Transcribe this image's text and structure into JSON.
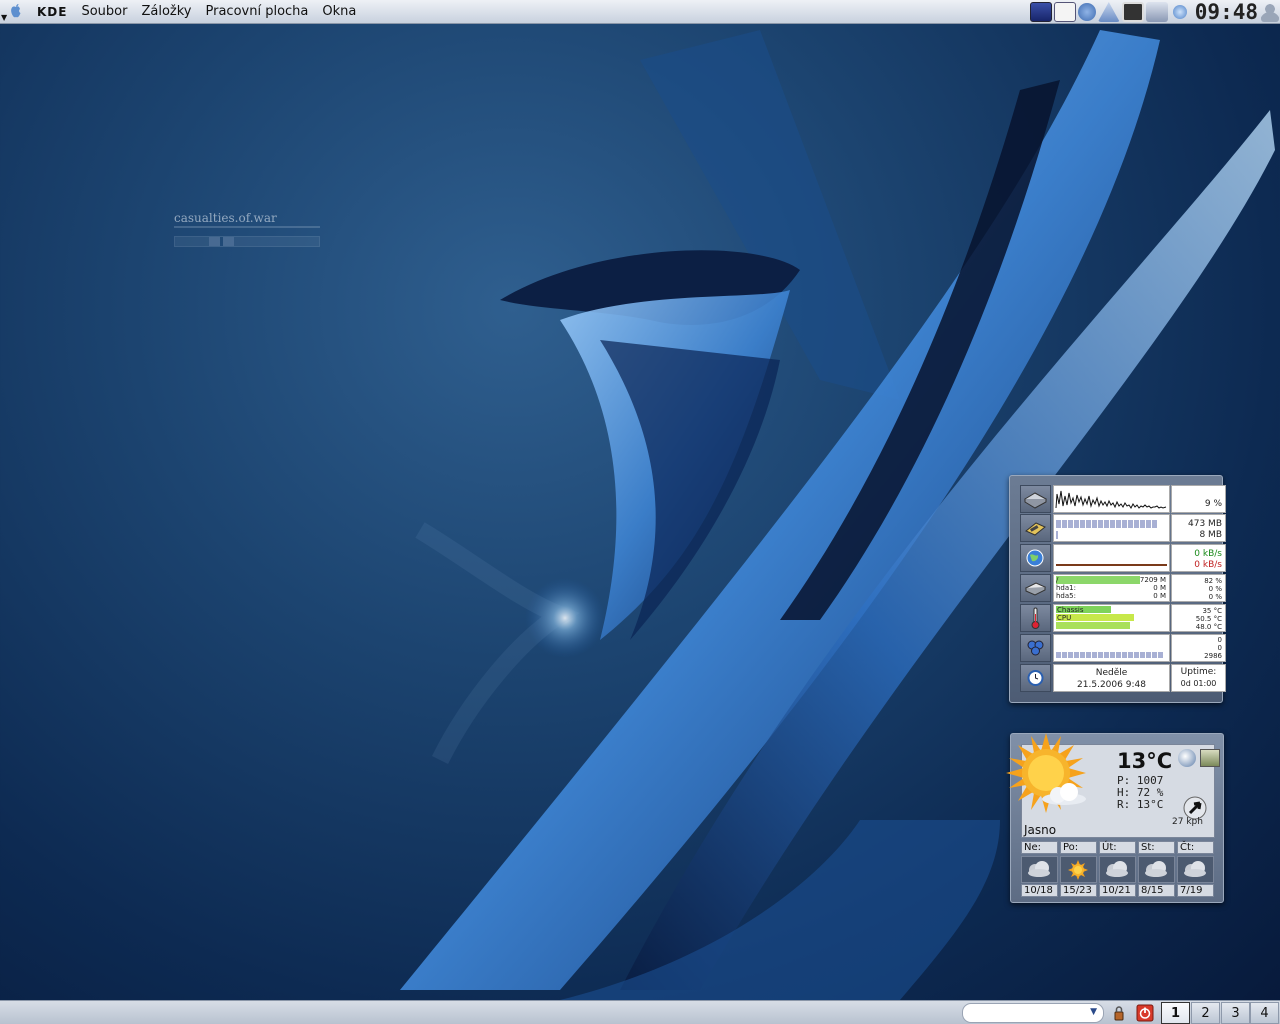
{
  "menubar": {
    "app_name": "KDE",
    "menus": [
      "Soubor",
      "Záložky",
      "Pracovní plocha",
      "Okna"
    ],
    "clock": "09:48"
  },
  "desktop_widget": {
    "title": "casualties.of.war"
  },
  "sysmon": {
    "cpu": {
      "value": "9 %"
    },
    "memory": {
      "ram": "473 MB",
      "swap": "8 MB"
    },
    "network": {
      "down": "0 kB/s",
      "up": "0 kB/s"
    },
    "disks": {
      "rows": [
        {
          "label": "/",
          "size": "7209 M",
          "pct": "82 %"
        },
        {
          "label": "hda1:",
          "size": "0 M",
          "pct": "0 %"
        },
        {
          "label": "hda5:",
          "size": "0 M",
          "pct": "0 %"
        }
      ]
    },
    "temps": {
      "rows": [
        {
          "label": "Chassis",
          "value": "35 °C"
        },
        {
          "label": "CPU",
          "value": "50.5 °C"
        },
        {
          "label": "",
          "value": "48.0 °C"
        }
      ]
    },
    "fans": {
      "values": [
        "0",
        "0",
        "2986"
      ]
    },
    "date": {
      "day": "Neděle",
      "datetime": "21.5.2006 9:48"
    },
    "uptime": {
      "label": "Uptime:",
      "value": "0d 01:00"
    }
  },
  "weather": {
    "temperature": "13°C",
    "pressure": "P: 1007",
    "humidity": "H: 72 %",
    "realfeel": "R: 13°C",
    "condition": "Jasno",
    "wind": "27 kph",
    "forecast": [
      {
        "day": "Ne:",
        "temps": "10/18",
        "icon": "cloudy-icon"
      },
      {
        "day": "Po:",
        "temps": "15/23",
        "icon": "sunny-icon"
      },
      {
        "day": "Út:",
        "temps": "10/21",
        "icon": "cloudy-icon"
      },
      {
        "day": "St:",
        "temps": "8/15",
        "icon": "cloudy-icon"
      },
      {
        "day": "Čt:",
        "temps": "7/19",
        "icon": "cloudy-icon"
      }
    ]
  },
  "bottombar": {
    "run_placeholder": "",
    "desktops": [
      "1",
      "2",
      "3",
      "4"
    ],
    "active_desktop": "1"
  }
}
